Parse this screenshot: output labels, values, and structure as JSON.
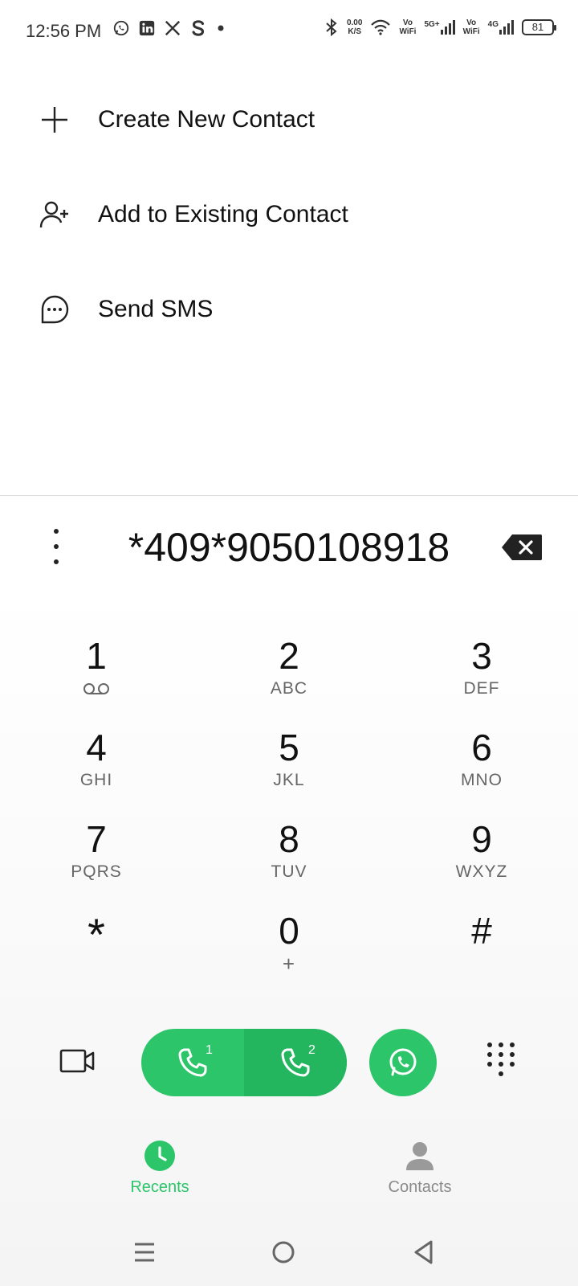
{
  "status_bar": {
    "time": "12:56 PM",
    "left_icons": [
      "whatsapp-icon",
      "linkedin-icon",
      "x-icon",
      "s-icon",
      "dot-icon"
    ],
    "speed_value": "0.00",
    "speed_unit": "K/S",
    "net1_label": "Vo",
    "net1_sub": "WiFi",
    "net2_label": "5G+",
    "net3_label": "Vo",
    "net3_sub": "WiFi",
    "net4_label": "4G",
    "battery": "81"
  },
  "actions": [
    {
      "label": "Create New Contact",
      "icon": "plus-icon"
    },
    {
      "label": "Add to Existing Contact",
      "icon": "add-person-icon"
    },
    {
      "label": "Send SMS",
      "icon": "chat-bubble-icon"
    }
  ],
  "dialer": {
    "number": "*409*9050108918"
  },
  "keypad": [
    [
      {
        "digit": "1",
        "letters": ""
      },
      {
        "digit": "2",
        "letters": "ABC"
      },
      {
        "digit": "3",
        "letters": "DEF"
      }
    ],
    [
      {
        "digit": "4",
        "letters": "GHI"
      },
      {
        "digit": "5",
        "letters": "JKL"
      },
      {
        "digit": "6",
        "letters": "MNO"
      }
    ],
    [
      {
        "digit": "7",
        "letters": "PQRS"
      },
      {
        "digit": "8",
        "letters": "TUV"
      },
      {
        "digit": "9",
        "letters": "WXYZ"
      }
    ],
    [
      {
        "digit": "*",
        "letters": ""
      },
      {
        "digit": "0",
        "letters": "+"
      },
      {
        "digit": "#",
        "letters": ""
      }
    ]
  ],
  "call_bar": {
    "sim1_label": "1",
    "sim2_label": "2"
  },
  "tabs": {
    "recents_label": "Recents",
    "contacts_label": "Contacts"
  },
  "colors": {
    "accent": "#2dc56a",
    "accent_dark": "#24b65f",
    "inactive": "#8a8a8a"
  }
}
